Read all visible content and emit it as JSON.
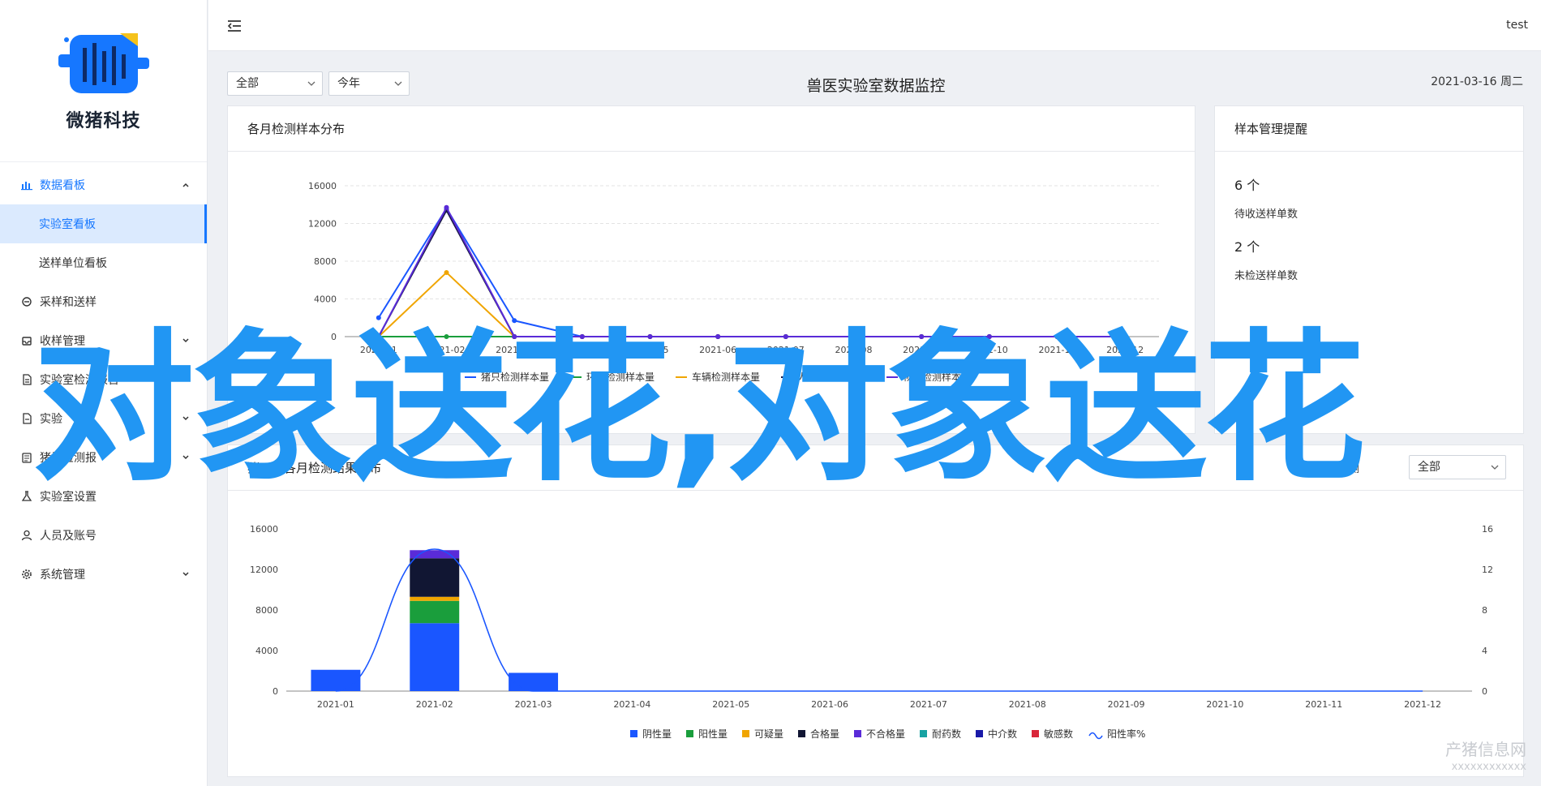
{
  "app": {
    "logo_text": "微猪科技",
    "user": "test"
  },
  "sidebar": {
    "items": [
      {
        "label": "数据看板",
        "icon": "bar-chart-icon",
        "expanded": true
      },
      {
        "label": "实验室看板",
        "sub": true,
        "active": true
      },
      {
        "label": "送样单位看板",
        "sub": true
      },
      {
        "label": "采样和送样",
        "icon": "sampling-icon"
      },
      {
        "label": "收样管理",
        "icon": "inbox-icon",
        "expandable": true
      },
      {
        "label": "实验室检测报告",
        "icon": "report-icon",
        "expandable": true
      },
      {
        "label": "实验",
        "icon": "experiment-icon",
        "expandable": true
      },
      {
        "label": "猪场检测报",
        "icon": "farm-report-icon",
        "expandable": true
      },
      {
        "label": "实验室设置",
        "icon": "lab-settings-icon"
      },
      {
        "label": "人员及账号",
        "icon": "user-icon"
      },
      {
        "label": "系统管理",
        "icon": "gear-icon",
        "expandable": true
      }
    ]
  },
  "toolbar": {
    "scope_value": "全部",
    "period_value": "今年",
    "title": "兽医实验室数据监控",
    "date": "2021-03-16 周二"
  },
  "monthly_panel": {
    "title": "各月检测样本分布"
  },
  "reminder_panel": {
    "title": "样本管理提醒",
    "pending_count": "6 个",
    "pending_label": "待收送样单数",
    "unchecked_count": "2 个",
    "unchecked_label": "未检送样单数"
  },
  "result_panel": {
    "title": "猪只样各月检测结果分布",
    "filter_label": "检测",
    "filter_value": "全部"
  },
  "overlay_text": "对象送花,对象送花",
  "watermark": {
    "line1": "产猪信息网",
    "line2": "xxxxxxxxxxxx"
  },
  "colors": {
    "accent": "#1677ff",
    "overlay": "#2196f3"
  },
  "chart_data": [
    {
      "type": "line",
      "title": "各月检测样本分布",
      "categories": [
        "2021-01",
        "2021-02",
        "2021-03",
        "2021-04",
        "2021-05",
        "2021-06",
        "2021-07",
        "2021-08",
        "2021-09",
        "2021-10",
        "2021-11",
        "2021-12"
      ],
      "ylim": [
        0,
        16000
      ],
      "yticks": [
        0,
        4000,
        8000,
        12000,
        16000
      ],
      "legend_position": "bottom",
      "series": [
        {
          "name": "猪只检测样本量",
          "color": "#1a56ff",
          "values": [
            2000,
            13600,
            1700,
            0,
            0,
            0,
            0,
            0,
            0,
            0,
            0,
            0
          ]
        },
        {
          "name": "环境检测样本量",
          "color": "#1a9e3c",
          "values": [
            0,
            0,
            0,
            0,
            0,
            0,
            0,
            0,
            0,
            0,
            0,
            0
          ]
        },
        {
          "name": "车辆检测样本量",
          "color": "#f0a500",
          "values": [
            0,
            6800,
            0,
            0,
            0,
            0,
            0,
            0,
            0,
            0,
            0,
            0
          ]
        },
        {
          "name": "人员检测样本量",
          "color": "#1a1a4a",
          "values": [
            0,
            13400,
            0,
            0,
            0,
            0,
            0,
            0,
            0,
            0,
            0,
            0
          ]
        },
        {
          "name": "物资检测样本量",
          "color": "#5a2bd8",
          "values": [
            0,
            13700,
            0,
            0,
            0,
            0,
            0,
            0,
            0,
            0,
            0,
            0
          ]
        }
      ]
    },
    {
      "type": "bar",
      "title": "猪只样各月检测结果分布",
      "stacked": true,
      "categories": [
        "2021-01",
        "2021-02",
        "2021-03",
        "2021-04",
        "2021-05",
        "2021-06",
        "2021-07",
        "2021-08",
        "2021-09",
        "2021-10",
        "2021-11",
        "2021-12"
      ],
      "ylim": [
        0,
        16000
      ],
      "yticks": [
        0,
        4000,
        8000,
        12000,
        16000
      ],
      "y2lim": [
        0,
        16
      ],
      "y2ticks": [
        0,
        4,
        8,
        12,
        16
      ],
      "legend_position": "bottom",
      "series": [
        {
          "name": "阴性量",
          "color": "#1a56ff",
          "values": [
            2100,
            6700,
            1800,
            0,
            0,
            0,
            0,
            0,
            0,
            0,
            0,
            0
          ]
        },
        {
          "name": "阳性量",
          "color": "#1a9e3c",
          "values": [
            0,
            2200,
            0,
            0,
            0,
            0,
            0,
            0,
            0,
            0,
            0,
            0
          ]
        },
        {
          "name": "可疑量",
          "color": "#f0a500",
          "values": [
            0,
            400,
            0,
            0,
            0,
            0,
            0,
            0,
            0,
            0,
            0,
            0
          ]
        },
        {
          "name": "合格量",
          "color": "#111633",
          "values": [
            0,
            3800,
            0,
            0,
            0,
            0,
            0,
            0,
            0,
            0,
            0,
            0
          ]
        },
        {
          "name": "不合格量",
          "color": "#5a2bd8",
          "values": [
            0,
            800,
            0,
            0,
            0,
            0,
            0,
            0,
            0,
            0,
            0,
            0
          ]
        },
        {
          "name": "耐药数",
          "color": "#17a2a2",
          "values": [
            0,
            0,
            0,
            0,
            0,
            0,
            0,
            0,
            0,
            0,
            0,
            0
          ]
        },
        {
          "name": "中介数",
          "color": "#1a1aa8",
          "values": [
            0,
            0,
            0,
            0,
            0,
            0,
            0,
            0,
            0,
            0,
            0,
            0
          ]
        },
        {
          "name": "敏感数",
          "color": "#d9263a",
          "values": [
            0,
            0,
            0,
            0,
            0,
            0,
            0,
            0,
            0,
            0,
            0,
            0
          ]
        }
      ],
      "line_series": {
        "name": "阳性率%",
        "color": "#1a56ff",
        "axis": "right",
        "values": [
          0,
          14,
          0,
          0,
          0,
          0,
          0,
          0,
          0,
          0,
          0,
          0
        ]
      }
    }
  ]
}
